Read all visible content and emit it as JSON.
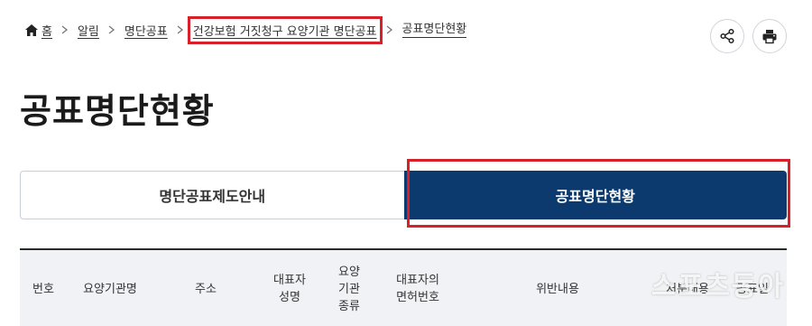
{
  "breadcrumb": {
    "items": [
      {
        "label": "홈"
      },
      {
        "label": "알림"
      },
      {
        "label": "명단공표"
      },
      {
        "label": "건강보험 거짓청구 요양기관 명단공표"
      },
      {
        "label": "공표명단현황"
      }
    ]
  },
  "page": {
    "title": "공표명단현황"
  },
  "tabs": [
    {
      "label": "명단공표제도안내",
      "active": false
    },
    {
      "label": "공표명단현황",
      "active": true
    }
  ],
  "table": {
    "headers": [
      "번호",
      "요양기관명",
      "주소",
      "대표자\n성명",
      "요양\n기관\n종류",
      "대표자의\n면허번호",
      "위반내용",
      "처분내용",
      "공표일"
    ]
  },
  "watermark": {
    "text": "스포츠동아"
  },
  "colors": {
    "active_tab": "#0c3a6e",
    "highlight": "#d8202b",
    "table_header_bg": "#f0f2f5"
  },
  "icons": {
    "home": "home-icon",
    "share": "share-icon",
    "print": "print-icon",
    "separator": "chevron-right-icon"
  }
}
